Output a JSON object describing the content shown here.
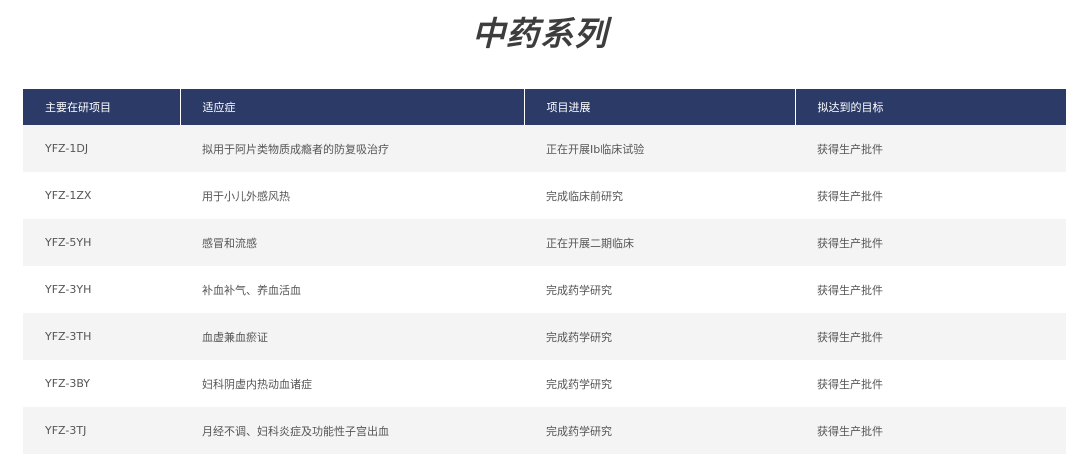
{
  "title": "中药系列",
  "table": {
    "headers": [
      "主要在研项目",
      "适应症",
      "项目进展",
      "拟达到的目标"
    ],
    "rows": [
      [
        "YFZ-1DJ",
        "拟用于阿片类物质成瘾者的防复吸治疗",
        "正在开展Ib临床试验",
        "获得生产批件"
      ],
      [
        "YFZ-1ZX",
        "用于小儿外感风热",
        "完成临床前研究",
        "获得生产批件"
      ],
      [
        "YFZ-5YH",
        "感冒和流感",
        "正在开展二期临床",
        "获得生产批件"
      ],
      [
        "YFZ-3YH",
        "补血补气、养血活血",
        "完成药学研究",
        "获得生产批件"
      ],
      [
        "YFZ-3TH",
        "血虚兼血瘀证",
        "完成药学研究",
        "获得生产批件"
      ],
      [
        "YFZ-3BY",
        "妇科阴虚内热动血诸症",
        "完成药学研究",
        "获得生产批件"
      ],
      [
        "YFZ-3TJ",
        "月经不调、妇科炎症及功能性子宫出血",
        "完成药学研究",
        "获得生产批件"
      ]
    ]
  },
  "colors": {
    "header_bg": "#2b3a67",
    "header_text": "#ffffff",
    "row_alt_bg": "#f4f4f4",
    "title_text": "#3d3d3d"
  }
}
